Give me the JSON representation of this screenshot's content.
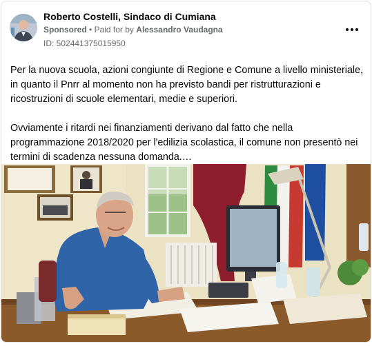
{
  "post": {
    "author": "Roberto Costelli, Sindaco di Cumiana",
    "sponsored_label": "Sponsored",
    "separator": "•",
    "paid_for_prefix": "Paid for by",
    "paid_for_name": "Alessandro Vaudagna",
    "ad_id": "ID: 502441375015950",
    "more_icon": "more-horizontal-icon",
    "paragraphs": [
      "Per la nuova scuola, azioni congiunte di Regione e Comune a livello ministeriale, in quanto il Pnrr al momento non ha previsto bandi per ristrutturazioni e ricostruzioni di scuole elementari, medie e superiori.",
      "Ovviamente i ritardi nei finanziamenti derivano dal fatto che nella programmazione 2018/2020 per l'edilizia scolastica, il comune non presentò nei termini di scadenza nessuna domanda.…"
    ]
  },
  "colors": {
    "text_primary": "#050505",
    "text_secondary": "#65676b",
    "border": "#dddfe2",
    "wall": "#ece3c6"
  }
}
